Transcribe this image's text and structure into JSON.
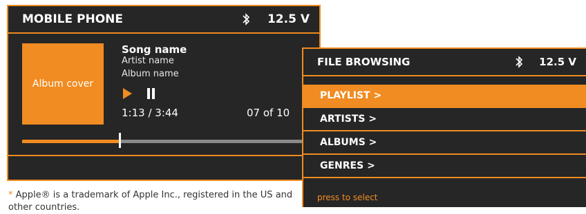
{
  "phone_screen": {
    "title": "MOBILE PHONE",
    "voltage": "12.5 V",
    "album_cover": "Album cover",
    "song": "Song name",
    "artist": "Artist name",
    "album": "Album name",
    "time": "1:13 / 3:44",
    "track": "07 of 10",
    "progress_fraction": 0.33
  },
  "file_screen": {
    "title": "FILE BROWSING",
    "voltage": "12.5 V",
    "items": [
      {
        "label": "PLAYLIST >",
        "active": true
      },
      {
        "label": "ARTISTS >",
        "active": false
      },
      {
        "label": "ALBUMS >",
        "active": false
      },
      {
        "label": "GENRES >",
        "active": false
      }
    ],
    "hint": "press to select"
  },
  "footnote": {
    "star": "*",
    "text": "Apple® is a trademark of Apple Inc., registered in the US and other countries."
  },
  "colors": {
    "accent": "#f08c22",
    "screen_bg": "#262626",
    "progress_track": "#8a8a8a"
  }
}
